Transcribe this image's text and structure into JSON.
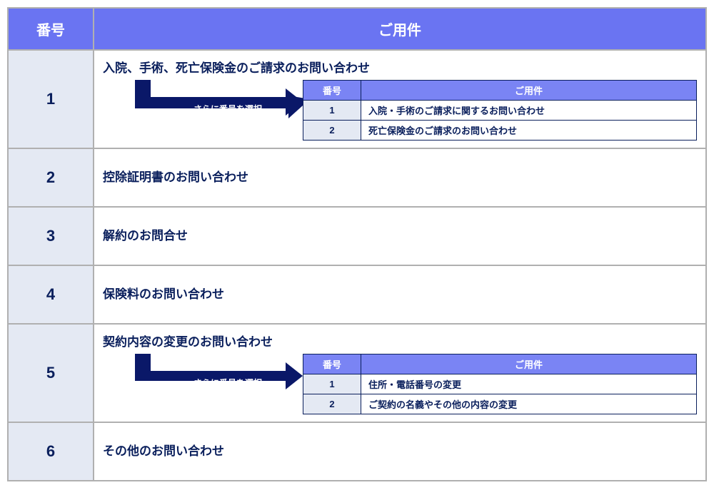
{
  "header": {
    "col_number": "番号",
    "col_topic": "ご用件"
  },
  "arrow_label": "さらに番号を選択",
  "sub_header": {
    "col_number": "番号",
    "col_topic": "ご用件"
  },
  "rows": [
    {
      "num": "1",
      "title": "入院、手術、死亡保険金のご請求のお問い合わせ",
      "sub": [
        {
          "num": "1",
          "text": "入院・手術のご請求に関するお問い合わせ"
        },
        {
          "num": "2",
          "text": "死亡保険金のご請求のお問い合わせ"
        }
      ]
    },
    {
      "num": "2",
      "title": "控除証明書のお問い合わせ"
    },
    {
      "num": "3",
      "title": "解約のお問合せ"
    },
    {
      "num": "4",
      "title": "保険料のお問い合わせ"
    },
    {
      "num": "5",
      "title": "契約内容の変更のお問い合わせ",
      "sub": [
        {
          "num": "1",
          "text": "住所・電話番号の変更"
        },
        {
          "num": "2",
          "text": "ご契約の名義やその他の内容の変更"
        }
      ]
    },
    {
      "num": "6",
      "title": "その他のお問い合わせ"
    }
  ]
}
